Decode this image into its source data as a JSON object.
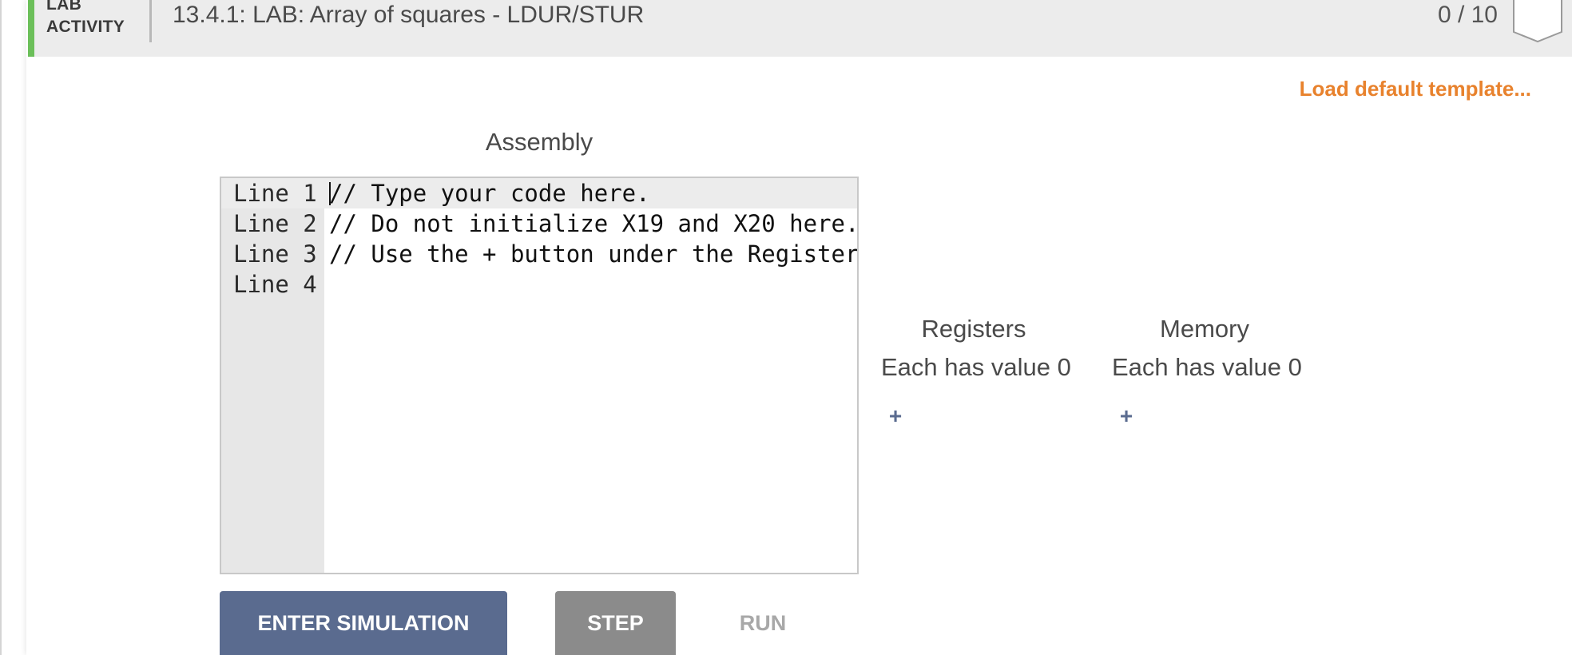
{
  "activity": {
    "type_line1": "LAB",
    "type_line2": "ACTIVITY",
    "title": "13.4.1: LAB: Array of squares - LDUR/STUR",
    "score": "0 / 10",
    "accent_color": "#6bbf59"
  },
  "toolbar": {
    "load_template_label": "Load default template..."
  },
  "editor": {
    "heading": "Assembly",
    "lines": [
      {
        "number": "Line 1",
        "code": "// Type your code here."
      },
      {
        "number": "Line 2",
        "code": "// Do not initialize X19 and X20 here."
      },
      {
        "number": "Line 3",
        "code": "// Use the + button under the Register c"
      },
      {
        "number": "Line 4",
        "code": ""
      }
    ]
  },
  "registers": {
    "heading": "Registers",
    "subtext": "Each has value 0",
    "add_label": "+"
  },
  "memory": {
    "heading": "Memory",
    "subtext": "Each has value 0",
    "add_label": "+"
  },
  "controls": {
    "enter_simulation_label": "ENTER SIMULATION",
    "step_label": "STEP",
    "run_label": "RUN"
  },
  "colors": {
    "link_orange": "#e8822d",
    "button_blue": "#5a6b8f",
    "button_gray": "#8b8b8b"
  },
  "icons": {
    "bookmark": "bookmark-icon",
    "add": "plus-icon"
  }
}
